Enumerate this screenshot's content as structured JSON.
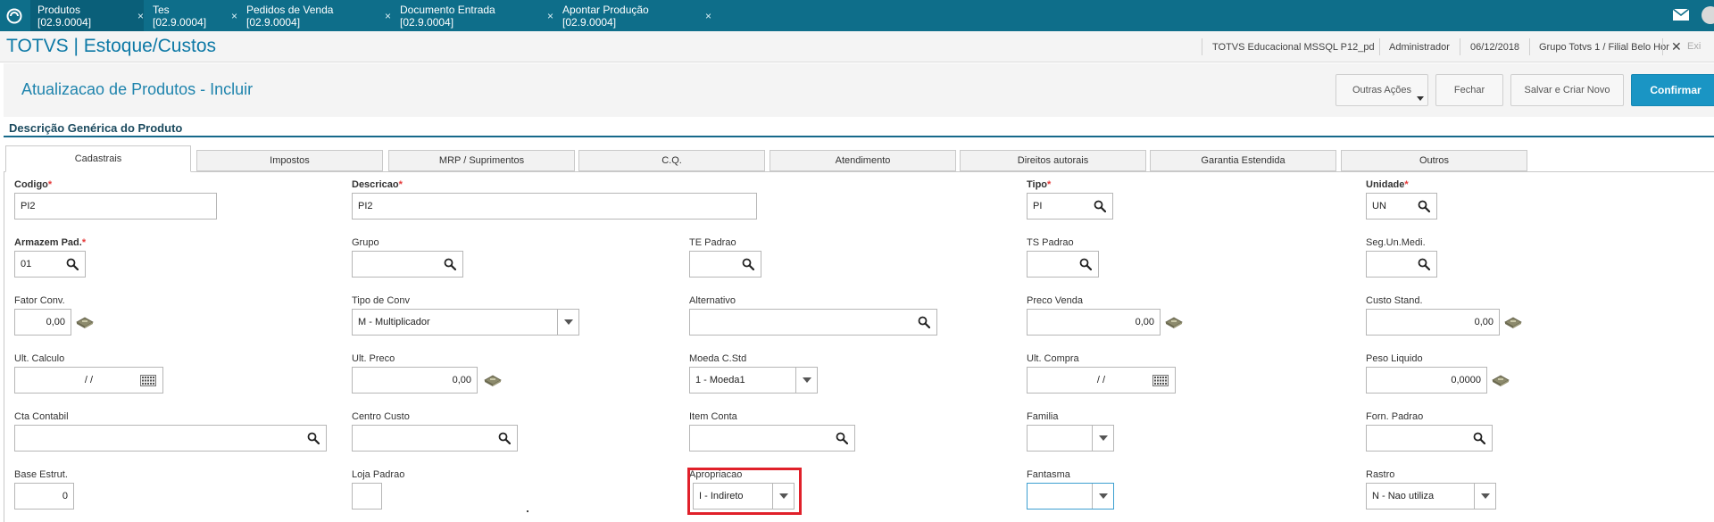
{
  "window_tabs": [
    {
      "label": "Produtos [02.9.0004]",
      "active": true
    },
    {
      "label": "Tes [02.9.0004]",
      "active": false
    },
    {
      "label": "Pedidos de Venda [02.9.0004]",
      "active": false
    },
    {
      "label": "Documento Entrada [02.9.0004]",
      "active": false
    },
    {
      "label": "Apontar Produção [02.9.0004]",
      "active": false
    }
  ],
  "tab_close": "×",
  "app_title": "TOTVS | Estoque/Custos",
  "header_info": {
    "environment": "TOTVS Educacional MSSQL P12_pd",
    "user": "Administrador",
    "date": "06/12/2018",
    "branch": "Grupo Totvs 1 / Filial Belo Hor",
    "close": "✕",
    "exit": "Exi"
  },
  "page_title": "Atualizacao de Produtos - Incluir",
  "actions": {
    "outras": "Outras Ações",
    "fechar": "Fechar",
    "salvar_novo": "Salvar e Criar Novo",
    "confirmar": "Confirmar"
  },
  "section_title": "Descrição Genérica do Produto",
  "content_tabs": [
    "Cadastrais",
    "Impostos",
    "MRP / Suprimentos",
    "C.Q.",
    "Atendimento",
    "Direitos autorais",
    "Garantia Estendida",
    "Outros"
  ],
  "required_mark": "*",
  "fields": {
    "codigo": {
      "label": "Codigo",
      "value": "PI2"
    },
    "descricao": {
      "label": "Descricao",
      "value": "PI2"
    },
    "tipo": {
      "label": "Tipo",
      "value": "PI"
    },
    "unidade": {
      "label": "Unidade",
      "value": "UN"
    },
    "armazem": {
      "label": "Armazem Pad.",
      "value": "01"
    },
    "grupo": {
      "label": "Grupo",
      "value": ""
    },
    "te_padrao": {
      "label": "TE Padrao",
      "value": ""
    },
    "ts_padrao": {
      "label": "TS Padrao",
      "value": ""
    },
    "seg_un": {
      "label": "Seg.Un.Medi.",
      "value": ""
    },
    "fator_conv": {
      "label": "Fator Conv.",
      "value": "0,00"
    },
    "tipo_conv": {
      "label": "Tipo de Conv",
      "value": "M - Multiplicador"
    },
    "alternativo": {
      "label": "Alternativo",
      "value": ""
    },
    "preco_venda": {
      "label": "Preco Venda",
      "value": "0,00"
    },
    "custo_stand": {
      "label": "Custo Stand.",
      "value": "0,00"
    },
    "ult_calculo": {
      "label": "Ult. Calculo",
      "value": "/ /"
    },
    "ult_preco": {
      "label": "Ult. Preco",
      "value": "0,00"
    },
    "moeda_cstd": {
      "label": "Moeda C.Std",
      "value": "1 - Moeda1"
    },
    "ult_compra": {
      "label": "Ult. Compra",
      "value": "/ /"
    },
    "peso_liquido": {
      "label": "Peso Liquido",
      "value": "0,0000"
    },
    "cta_contabil": {
      "label": "Cta Contabil",
      "value": ""
    },
    "centro_custo": {
      "label": "Centro Custo",
      "value": ""
    },
    "item_conta": {
      "label": "Item Conta",
      "value": ""
    },
    "familia": {
      "label": "Familia",
      "value": ""
    },
    "forn_padrao": {
      "label": "Forn. Padrao",
      "value": ""
    },
    "base_estrut": {
      "label": "Base Estrut.",
      "value": "0"
    },
    "loja_padrao": {
      "label": "Loja Padrao",
      "value": ""
    },
    "apropriacao": {
      "label": "Apropriacao",
      "value": "I - Indireto"
    },
    "fantasma": {
      "label": "Fantasma",
      "value": ""
    },
    "rastro": {
      "label": "Rastro",
      "value": "N - Nao utiliza"
    }
  },
  "colors": {
    "topbar": "#0e6e8a",
    "accent": "#1a95c4",
    "highlight": "#e0202a"
  }
}
